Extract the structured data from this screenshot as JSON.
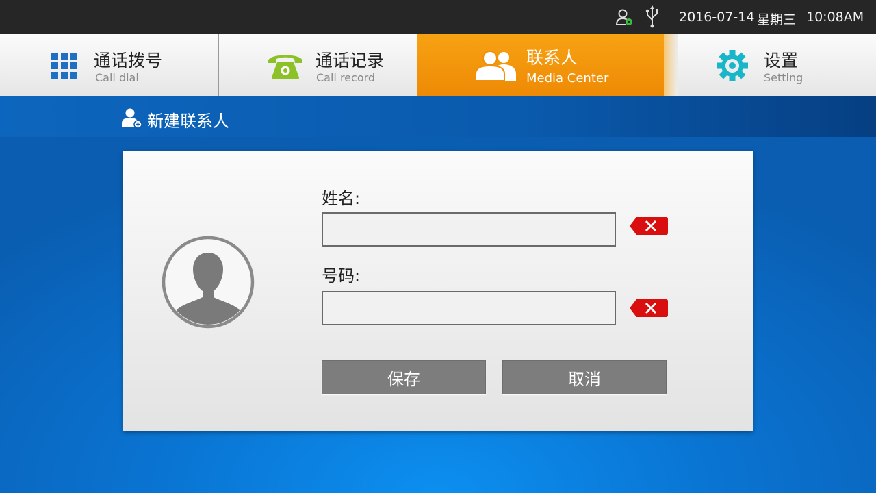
{
  "status_bar": {
    "date": "2016-07-14",
    "weekday": "星期三",
    "time": "10:08AM",
    "icons": [
      "user-status-icon",
      "usb-icon"
    ]
  },
  "tabs": [
    {
      "title": "通话拨号",
      "subtitle": "Call dial",
      "icon": "dialpad-icon",
      "active": false
    },
    {
      "title": "通话记录",
      "subtitle": "Call record",
      "icon": "telephone-icon",
      "active": false
    },
    {
      "title": "联系人",
      "subtitle": "Media Center",
      "icon": "contacts-icon",
      "active": true
    },
    {
      "title": "设置",
      "subtitle": "Setting",
      "icon": "gear-icon",
      "active": false
    }
  ],
  "section": {
    "title": "新建联系人",
    "icon": "add-contact-icon"
  },
  "form": {
    "name_label": "姓名:",
    "name_value": "",
    "number_label": "号码:",
    "number_value": "",
    "save_label": "保存",
    "cancel_label": "取消"
  },
  "colors": {
    "active_tab": "#f39a0d",
    "header_blue": "#0a5aad",
    "background_blue": "#0a74d2",
    "clear_red": "#d90f0f",
    "button_gray": "#7d7d7d",
    "dialpad_blue": "#1f6fc2",
    "phone_green": "#8cc128",
    "gear_teal": "#19b6c9"
  }
}
